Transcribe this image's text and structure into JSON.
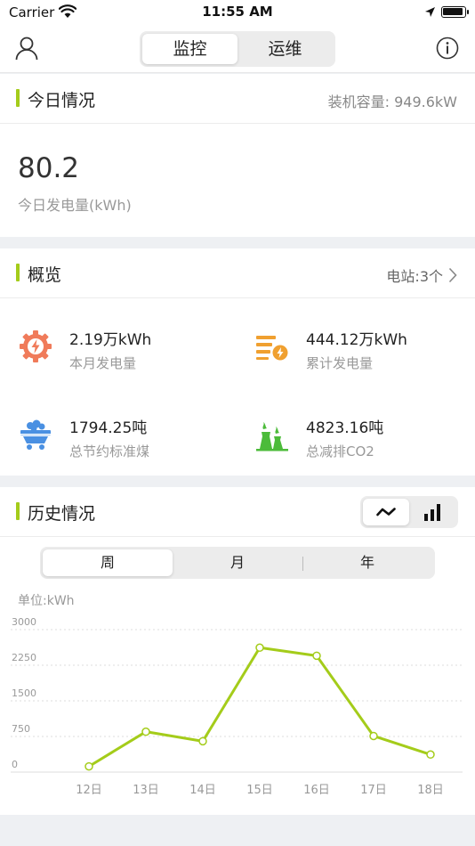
{
  "status_bar": {
    "carrier": "Carrier",
    "time": "11:55 AM"
  },
  "nav": {
    "tabs": [
      {
        "label": "监控",
        "active": true
      },
      {
        "label": "运维",
        "active": false
      }
    ]
  },
  "today": {
    "title": "今日情况",
    "capacity": "装机容量: 949.6kW",
    "value": "80.2",
    "label": "今日发电量(kWh)"
  },
  "overview": {
    "title": "概览",
    "stations": "电站:3个",
    "stats": [
      {
        "value": "2.19万kWh",
        "label": "本月发电量",
        "icon": "gear-bolt-icon",
        "color": "#f07b5a"
      },
      {
        "value": "444.12万kWh",
        "label": "累计发电量",
        "icon": "energy-total-icon",
        "color": "#f0a030"
      },
      {
        "value": "1794.25吨",
        "label": "总节约标准煤",
        "icon": "coal-cart-icon",
        "color": "#4a90e2"
      },
      {
        "value": "4823.16吨",
        "label": "总减排CO2",
        "icon": "cooling-tower-icon",
        "color": "#4cbb3a"
      }
    ]
  },
  "history": {
    "title": "历史情况",
    "periods": [
      {
        "label": "周",
        "active": true
      },
      {
        "label": "月",
        "active": false
      },
      {
        "label": "年",
        "active": false
      }
    ],
    "unit": "单位:kWh"
  },
  "chart_data": {
    "type": "line",
    "categories": [
      "12日",
      "13日",
      "14日",
      "15日",
      "16日",
      "17日",
      "18日"
    ],
    "values": [
      120,
      850,
      650,
      2620,
      2450,
      760,
      370
    ],
    "yticks": [
      0,
      750,
      1500,
      2250,
      3000
    ],
    "yticklabels": [
      "0",
      "750",
      "1500",
      "2250",
      "3000"
    ],
    "ylim": [
      0,
      3000
    ],
    "line_color": "#a4cc1a",
    "grid": true
  }
}
